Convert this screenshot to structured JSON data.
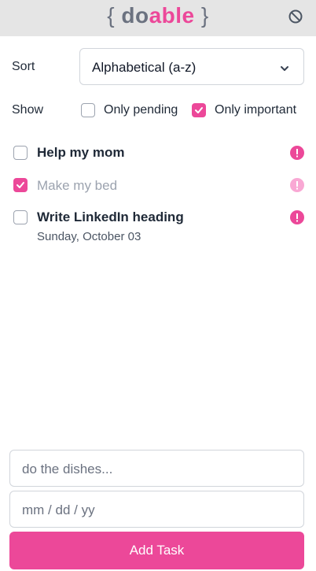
{
  "header": {
    "logo_open": "{",
    "logo_part1": "do",
    "logo_part2": "able",
    "logo_close": "}",
    "brand_color": "#ec4899",
    "action_icon": "block-icon"
  },
  "controls": {
    "sort_label": "Sort",
    "sort_value": "Alphabetical (a-z)",
    "show_label": "Show",
    "only_pending_label": "Only pending",
    "only_pending_checked": false,
    "only_important_label": "Only important",
    "only_important_checked": true
  },
  "tasks": [
    {
      "title": "Help my mom",
      "completed": false,
      "important": true,
      "date": ""
    },
    {
      "title": "Make my bed",
      "completed": true,
      "important": true,
      "date": ""
    },
    {
      "title": "Write LinkedIn heading",
      "completed": false,
      "important": true,
      "date": "Sunday, October 03"
    }
  ],
  "form": {
    "task_placeholder": "do the dishes...",
    "date_placeholder": "mm / dd / yy",
    "submit_label": "Add Task"
  }
}
